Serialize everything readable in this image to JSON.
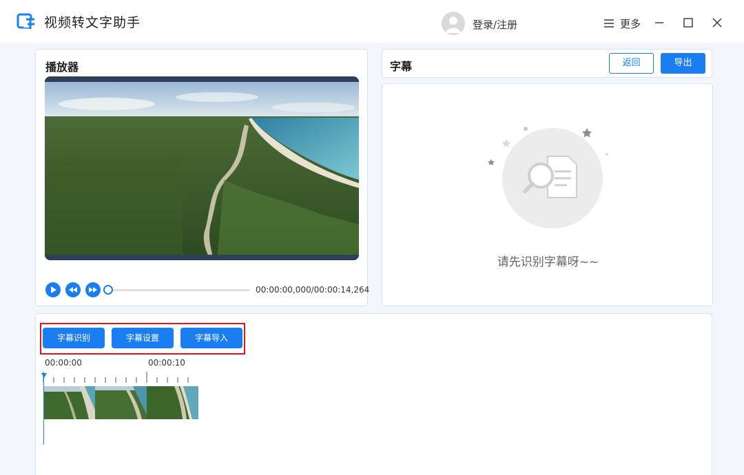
{
  "app": {
    "title": "视频转文字助手"
  },
  "header": {
    "login_text": "登录/注册",
    "more_label": "更多"
  },
  "player": {
    "title": "播放器",
    "time_readout": "00:00:00,000/00:00:14,264",
    "progress": 0
  },
  "subtitle": {
    "title": "字幕",
    "back_label": "返回",
    "export_label": "导出",
    "empty_message": "请先识别字幕呀~~"
  },
  "timeline": {
    "buttons": [
      "字幕识别",
      "字幕设置",
      "字幕导入"
    ],
    "time_marks": [
      "00:00:00",
      "00:00:10"
    ]
  },
  "colors": {
    "accent": "#1a7ef0",
    "highlight": "#e1151c",
    "background": "#f3f7fd"
  },
  "icons": [
    "app-logo-icon",
    "user-avatar-icon",
    "menu-icon",
    "minimize-icon",
    "maximize-icon",
    "close-icon",
    "play-icon",
    "rewind-icon",
    "fast-forward-icon",
    "document-search-icon"
  ]
}
